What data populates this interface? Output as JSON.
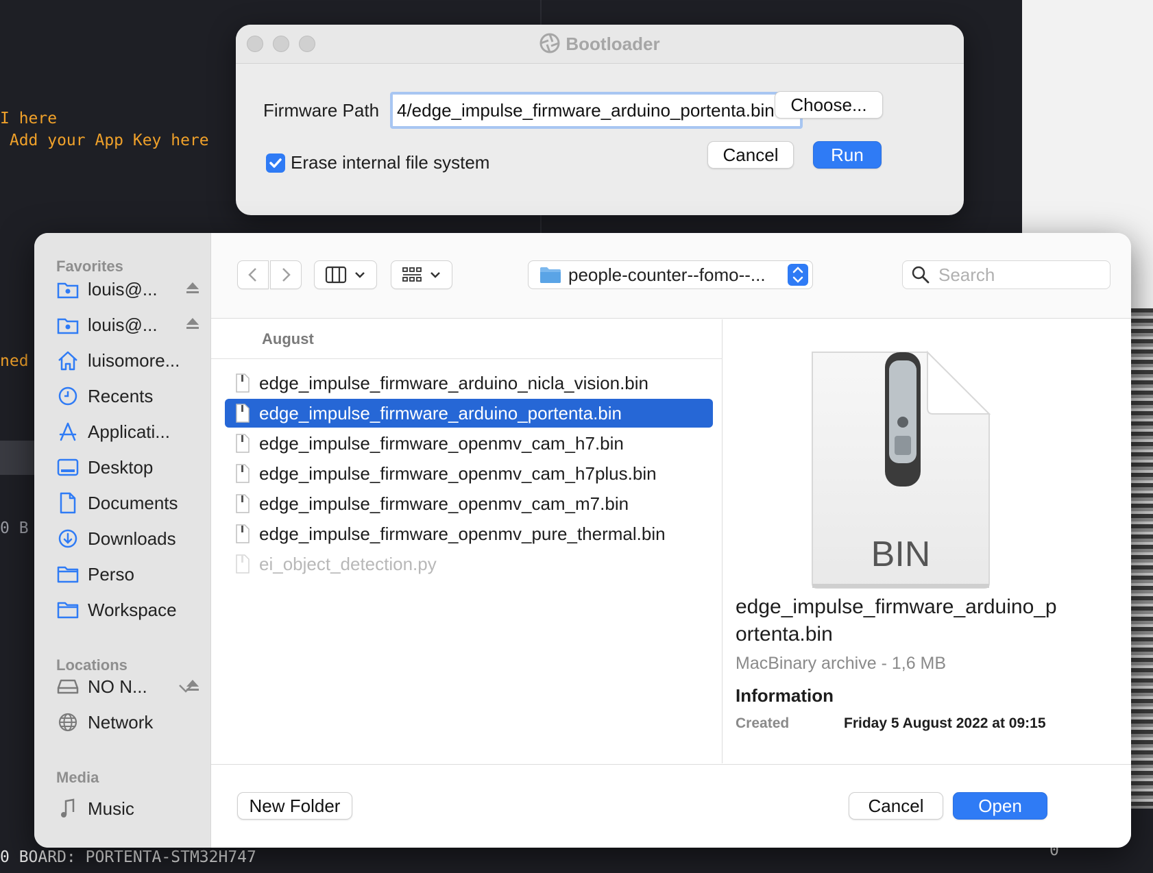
{
  "terminal": {
    "line1": "I here",
    "line2": " Add your App Key here",
    "line3": "ned",
    "line4": "0 B",
    "line5": "0 BOARD: PORTENTA-STM32H747",
    "line6": "0"
  },
  "bootloader": {
    "title": "Bootloader",
    "firmware_label": "Firmware Path",
    "firmware_path": "4/edge_impulse_firmware_arduino_portenta.bin",
    "choose_label": "Choose...",
    "erase_label": "Erase internal file system",
    "erase_checked": true,
    "cancel_label": "Cancel",
    "run_label": "Run",
    "accent": "#2f7bf5"
  },
  "open_panel": {
    "sidebar": {
      "favorites_title": "Favorites",
      "favorites": [
        {
          "label": "louis@...",
          "icon": "shared-folder-icon",
          "eject": true
        },
        {
          "label": "louis@...",
          "icon": "shared-folder-icon",
          "eject": true
        },
        {
          "label": "luisomore...",
          "icon": "home-icon",
          "eject": false
        },
        {
          "label": "Recents",
          "icon": "clock-icon",
          "eject": false
        },
        {
          "label": "Applicati...",
          "icon": "applications-icon",
          "eject": false
        },
        {
          "label": "Desktop",
          "icon": "desktop-icon",
          "eject": false
        },
        {
          "label": "Documents",
          "icon": "document-icon",
          "eject": false
        },
        {
          "label": "Downloads",
          "icon": "download-icon",
          "eject": false
        },
        {
          "label": "Perso",
          "icon": "folder-icon",
          "eject": false
        },
        {
          "label": "Workspace",
          "icon": "folder-icon",
          "eject": false
        }
      ],
      "locations_title": "Locations",
      "locations": [
        {
          "label": "NO N...",
          "icon": "drive-icon",
          "eject": true
        },
        {
          "label": "Network",
          "icon": "network-icon",
          "eject": false
        }
      ],
      "media_title": "Media",
      "media": [
        {
          "label": "Music",
          "icon": "music-icon"
        }
      ]
    },
    "toolbar": {
      "folder_name": "people-counter--fomo--...",
      "search_placeholder": "Search"
    },
    "file_list": {
      "group": "August",
      "files": [
        {
          "name": "edge_impulse_firmware_arduino_nicla_vision.bin",
          "selected": false,
          "disabled": false
        },
        {
          "name": "edge_impulse_firmware_arduino_portenta.bin",
          "selected": true,
          "disabled": false
        },
        {
          "name": "edge_impulse_firmware_openmv_cam_h7.bin",
          "selected": false,
          "disabled": false
        },
        {
          "name": "edge_impulse_firmware_openmv_cam_h7plus.bin",
          "selected": false,
          "disabled": false
        },
        {
          "name": "edge_impulse_firmware_openmv_cam_m7.bin",
          "selected": false,
          "disabled": false
        },
        {
          "name": "edge_impulse_firmware_openmv_pure_thermal.bin",
          "selected": false,
          "disabled": false
        },
        {
          "name": "ei_object_detection.py",
          "selected": false,
          "disabled": true
        }
      ]
    },
    "preview": {
      "icon_text": "BIN",
      "file_name": "edge_impulse_firmware_arduino_portenta.bin",
      "kind": "MacBinary archive - 1,6 MB",
      "info_title": "Information",
      "created_label": "Created",
      "created_value": "Friday 5 August 2022 at 09:15"
    },
    "footer": {
      "new_folder_label": "New Folder",
      "cancel_label": "Cancel",
      "open_label": "Open"
    },
    "selection_color": "#2667d6"
  }
}
